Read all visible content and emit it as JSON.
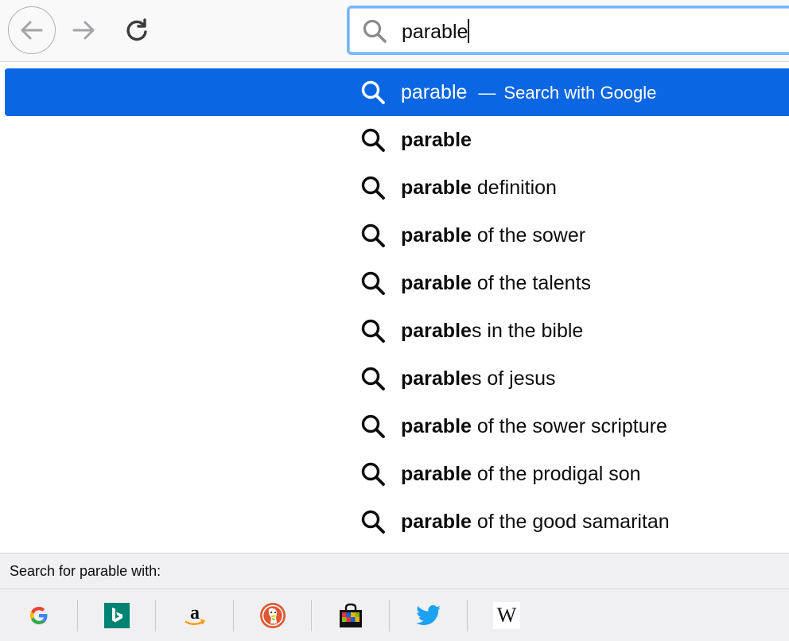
{
  "toolbar": {
    "back_icon": "arrow-left-icon",
    "forward_icon": "arrow-right-icon",
    "reload_icon": "reload-icon"
  },
  "urlbar": {
    "icon": "search-icon",
    "value": "parable"
  },
  "results": [
    {
      "icon": "search-icon",
      "bold": "",
      "term": "parable",
      "dash": "—",
      "action": "Search with Google",
      "selected": true
    },
    {
      "icon": "search-icon",
      "bold": "parable",
      "rest": ""
    },
    {
      "icon": "search-icon",
      "bold": "parable",
      "rest": " definition"
    },
    {
      "icon": "search-icon",
      "bold": "parable",
      "rest": " of the sower"
    },
    {
      "icon": "search-icon",
      "bold": "parable",
      "rest": " of the talents"
    },
    {
      "icon": "search-icon",
      "bold": "parable",
      "rest": "s in the bible"
    },
    {
      "icon": "search-icon",
      "bold": "parable",
      "rest": "s of jesus"
    },
    {
      "icon": "search-icon",
      "bold": "parable",
      "rest": " of the sower scripture"
    },
    {
      "icon": "search-icon",
      "bold": "parable",
      "rest": " of the prodigal son"
    },
    {
      "icon": "search-icon",
      "bold": "parable",
      "rest": " of the good samaritan"
    }
  ],
  "oneoff": {
    "header": "Search for parable with:",
    "engines": [
      {
        "name": "google-engine",
        "icon": "google-icon"
      },
      {
        "name": "bing-engine",
        "icon": "bing-icon"
      },
      {
        "name": "amazon-engine",
        "icon": "amazon-icon"
      },
      {
        "name": "duckduckgo-engine",
        "icon": "duckduckgo-icon"
      },
      {
        "name": "ebay-engine",
        "icon": "shopping-bag-icon"
      },
      {
        "name": "twitter-engine",
        "icon": "twitter-bird-icon"
      },
      {
        "name": "wikipedia-engine",
        "icon": "wikipedia-icon",
        "label": "W"
      }
    ]
  },
  "colors": {
    "selected_row": "#0a66e3",
    "focus_ring": "#75b5fb"
  }
}
